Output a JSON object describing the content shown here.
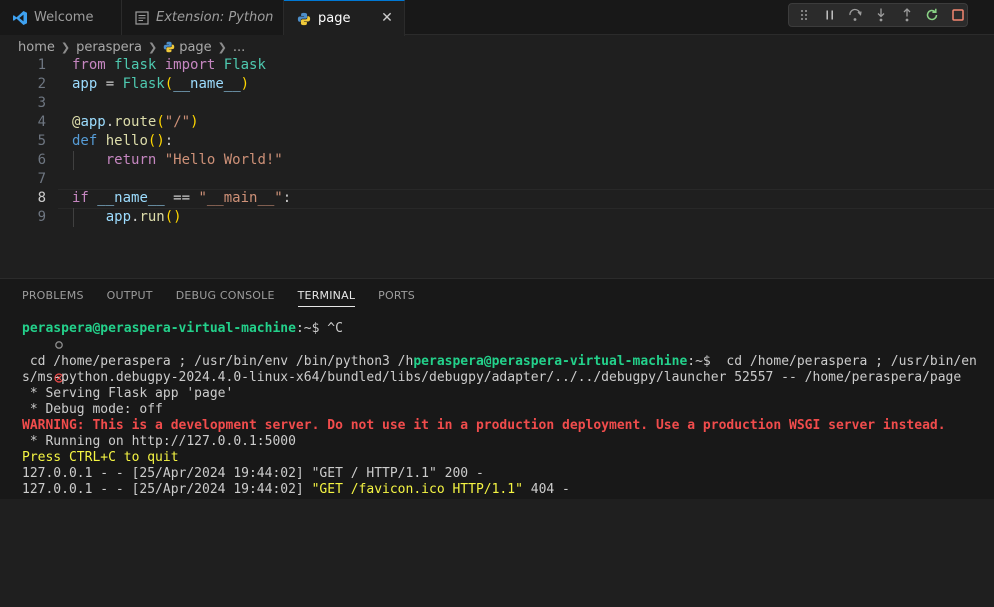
{
  "tabs": [
    {
      "label": "Welcome",
      "icon": "vscode-icon",
      "state": "inactive"
    },
    {
      "label": "Extension: Python",
      "icon": "extension-doc-icon",
      "state": "inactive"
    },
    {
      "label": "page",
      "icon": "python-icon",
      "state": "active"
    }
  ],
  "debug_toolbar": {
    "buttons": [
      "drag-handle",
      "pause",
      "step-over",
      "step-into",
      "step-out",
      "restart",
      "stop"
    ]
  },
  "breadcrumb": [
    "home",
    "peraspera",
    "page",
    "..."
  ],
  "editor": {
    "current_line": 8,
    "lines": [
      {
        "n": "1",
        "text": "from flask import Flask"
      },
      {
        "n": "2",
        "text": "app = Flask(__name__)"
      },
      {
        "n": "3",
        "text": ""
      },
      {
        "n": "4",
        "text": "@app.route(\"/\")"
      },
      {
        "n": "5",
        "text": "def hello():"
      },
      {
        "n": "6",
        "text": "    return \"Hello World!\""
      },
      {
        "n": "7",
        "text": ""
      },
      {
        "n": "8",
        "text": "if __name__ == \"__main__\":"
      },
      {
        "n": "9",
        "text": "    app.run()"
      }
    ]
  },
  "panel": {
    "tabs": [
      "PROBLEMS",
      "OUTPUT",
      "DEBUG CONSOLE",
      "TERMINAL",
      "PORTS"
    ],
    "active_tab": "TERMINAL"
  },
  "terminal": {
    "prompt_user": "peraspera@peraspera-virtual-machine",
    "prompt_path": ":~$ ",
    "line1_cmd": "^C",
    "line2_pre": " cd /home/peraspera ; /usr/bin/env /bin/python3 /h",
    "line2_user": "peraspera@peraspera-virtual-machine",
    "line2_path": ":~$ ",
    "line2_post": " cd /home/peraspera ; /usr/bin/en",
    "line3": "s/ms-python.debugpy-2024.4.0-linux-x64/bundled/libs/debugpy/adapter/../../debugpy/launcher 52557 -- /home/peraspera/page",
    "line4": " * Serving Flask app 'page'",
    "line5": " * Debug mode: off",
    "line6": "WARNING: This is a development server. Do not use it in a production deployment. Use a production WSGI server instead.",
    "line7": " * Running on http://127.0.0.1:5000",
    "line8": "Press CTRL+C to quit",
    "line9": "127.0.0.1 - - [25/Apr/2024 19:44:02] \"GET / HTTP/1.1\" 200 -",
    "line10_pre": "127.0.0.1 - - [25/Apr/2024 19:44:02] ",
    "line10_req": "\"GET /favicon.ico HTTP/1.1\"",
    "line10_post": " 404 -"
  },
  "colors": {
    "accent": "#0078d4",
    "prompt_green": "#23d18b",
    "error_red": "#f14c4c",
    "warn_yellow": "#f5f543"
  }
}
